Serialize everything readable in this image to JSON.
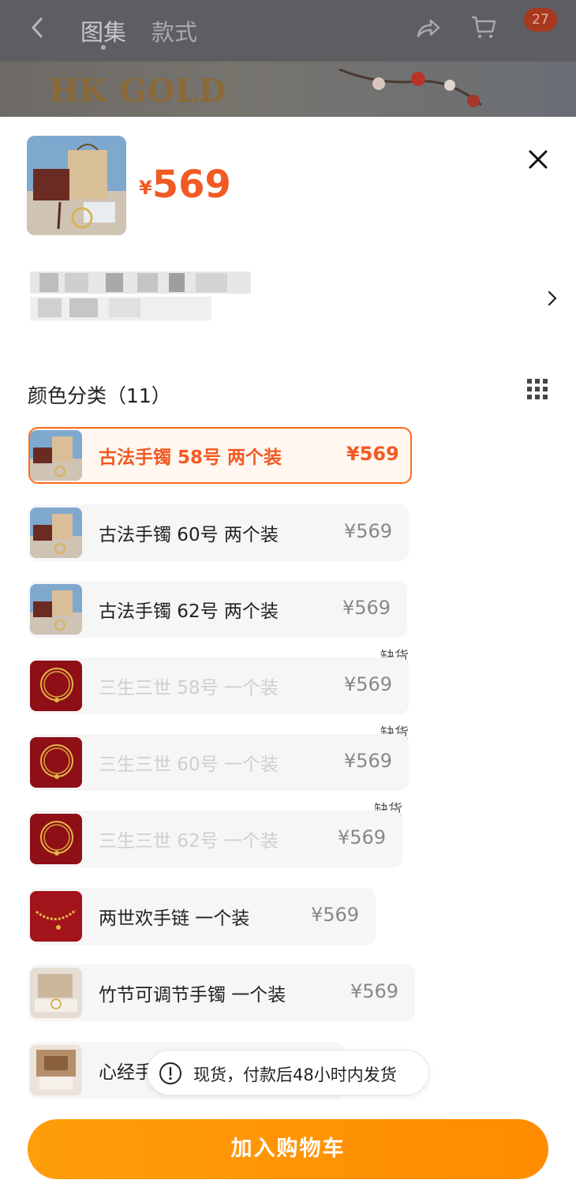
{
  "background": {
    "tabs": [
      "图集",
      "款式"
    ],
    "cart_badge": "27",
    "banner_logo": "HK GOLD"
  },
  "product": {
    "price_symbol": "¥",
    "price": "569"
  },
  "options_section": {
    "title": "颜色分类（11）"
  },
  "options": [
    {
      "label": "古法手镯  58号 两个装",
      "price": "¥569",
      "selected": true,
      "out_of_stock": false,
      "image": "gift-box"
    },
    {
      "label": "古法手镯  60号 两个装",
      "price": "¥569",
      "selected": false,
      "out_of_stock": false,
      "image": "gift-box"
    },
    {
      "label": "古法手镯  62号 两个装",
      "price": "¥569",
      "selected": false,
      "out_of_stock": false,
      "image": "gift-box"
    },
    {
      "label": "三生三世  58号 一个装",
      "price": "¥569",
      "selected": false,
      "out_of_stock": true,
      "image": "red-card"
    },
    {
      "label": "三生三世  60号 一个装",
      "price": "¥569",
      "selected": false,
      "out_of_stock": true,
      "image": "red-card"
    },
    {
      "label": "三生三世 62号 一个装",
      "price": "¥569",
      "selected": false,
      "out_of_stock": true,
      "image": "red-card"
    },
    {
      "label": "两世欢手链 一个装",
      "price": "¥569",
      "selected": false,
      "out_of_stock": false,
      "image": "red-chain"
    },
    {
      "label": "竹节可调节手镯 一个装",
      "price": "¥569",
      "selected": false,
      "out_of_stock": false,
      "image": "light-box"
    },
    {
      "label": "心经手",
      "price": "",
      "selected": false,
      "out_of_stock": false,
      "image": "wood-box"
    }
  ],
  "out_of_stock_label": "缺货",
  "toast": {
    "text": "现货，付款后48小时内发货"
  },
  "add_to_cart": "加入购物车",
  "colors": {
    "accent": "#f15a24",
    "button": "#ff9500",
    "selected_border": "#ff6a1a"
  }
}
